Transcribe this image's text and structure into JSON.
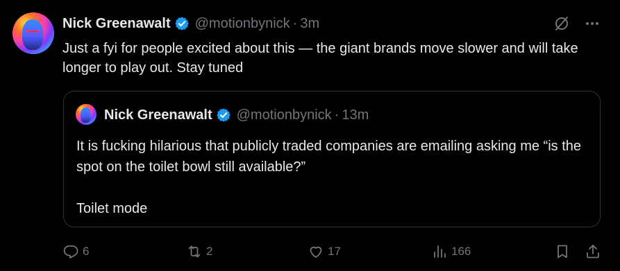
{
  "tweet": {
    "author_name": "Nick Greenawalt",
    "handle": "@motionbynick",
    "separator": "·",
    "time": "3m",
    "text": "Just a fyi for people excited about this — the giant brands move slower and will take longer to play out. Stay tuned"
  },
  "quote": {
    "author_name": "Nick Greenawalt",
    "handle": "@motionbynick",
    "separator": "·",
    "time": "13m",
    "line1": "It is fucking hilarious that publicly traded companies are emailing asking me “is the spot on the toilet bowl still available?”",
    "line2": "Toilet mode"
  },
  "actions": {
    "replies": "6",
    "reposts": "2",
    "likes": "17",
    "views": "166"
  },
  "icons": {
    "verified": "verified-badge-icon",
    "grok": "grok-icon",
    "more": "more-icon",
    "reply": "reply-icon",
    "repost": "repost-icon",
    "like": "heart-icon",
    "views": "views-icon",
    "bookmark": "bookmark-icon",
    "share": "share-icon"
  },
  "colors": {
    "background": "#000000",
    "text": "#e7e9ea",
    "muted": "#71767b",
    "verified": "#1d9bf0",
    "border": "#2f3336"
  }
}
